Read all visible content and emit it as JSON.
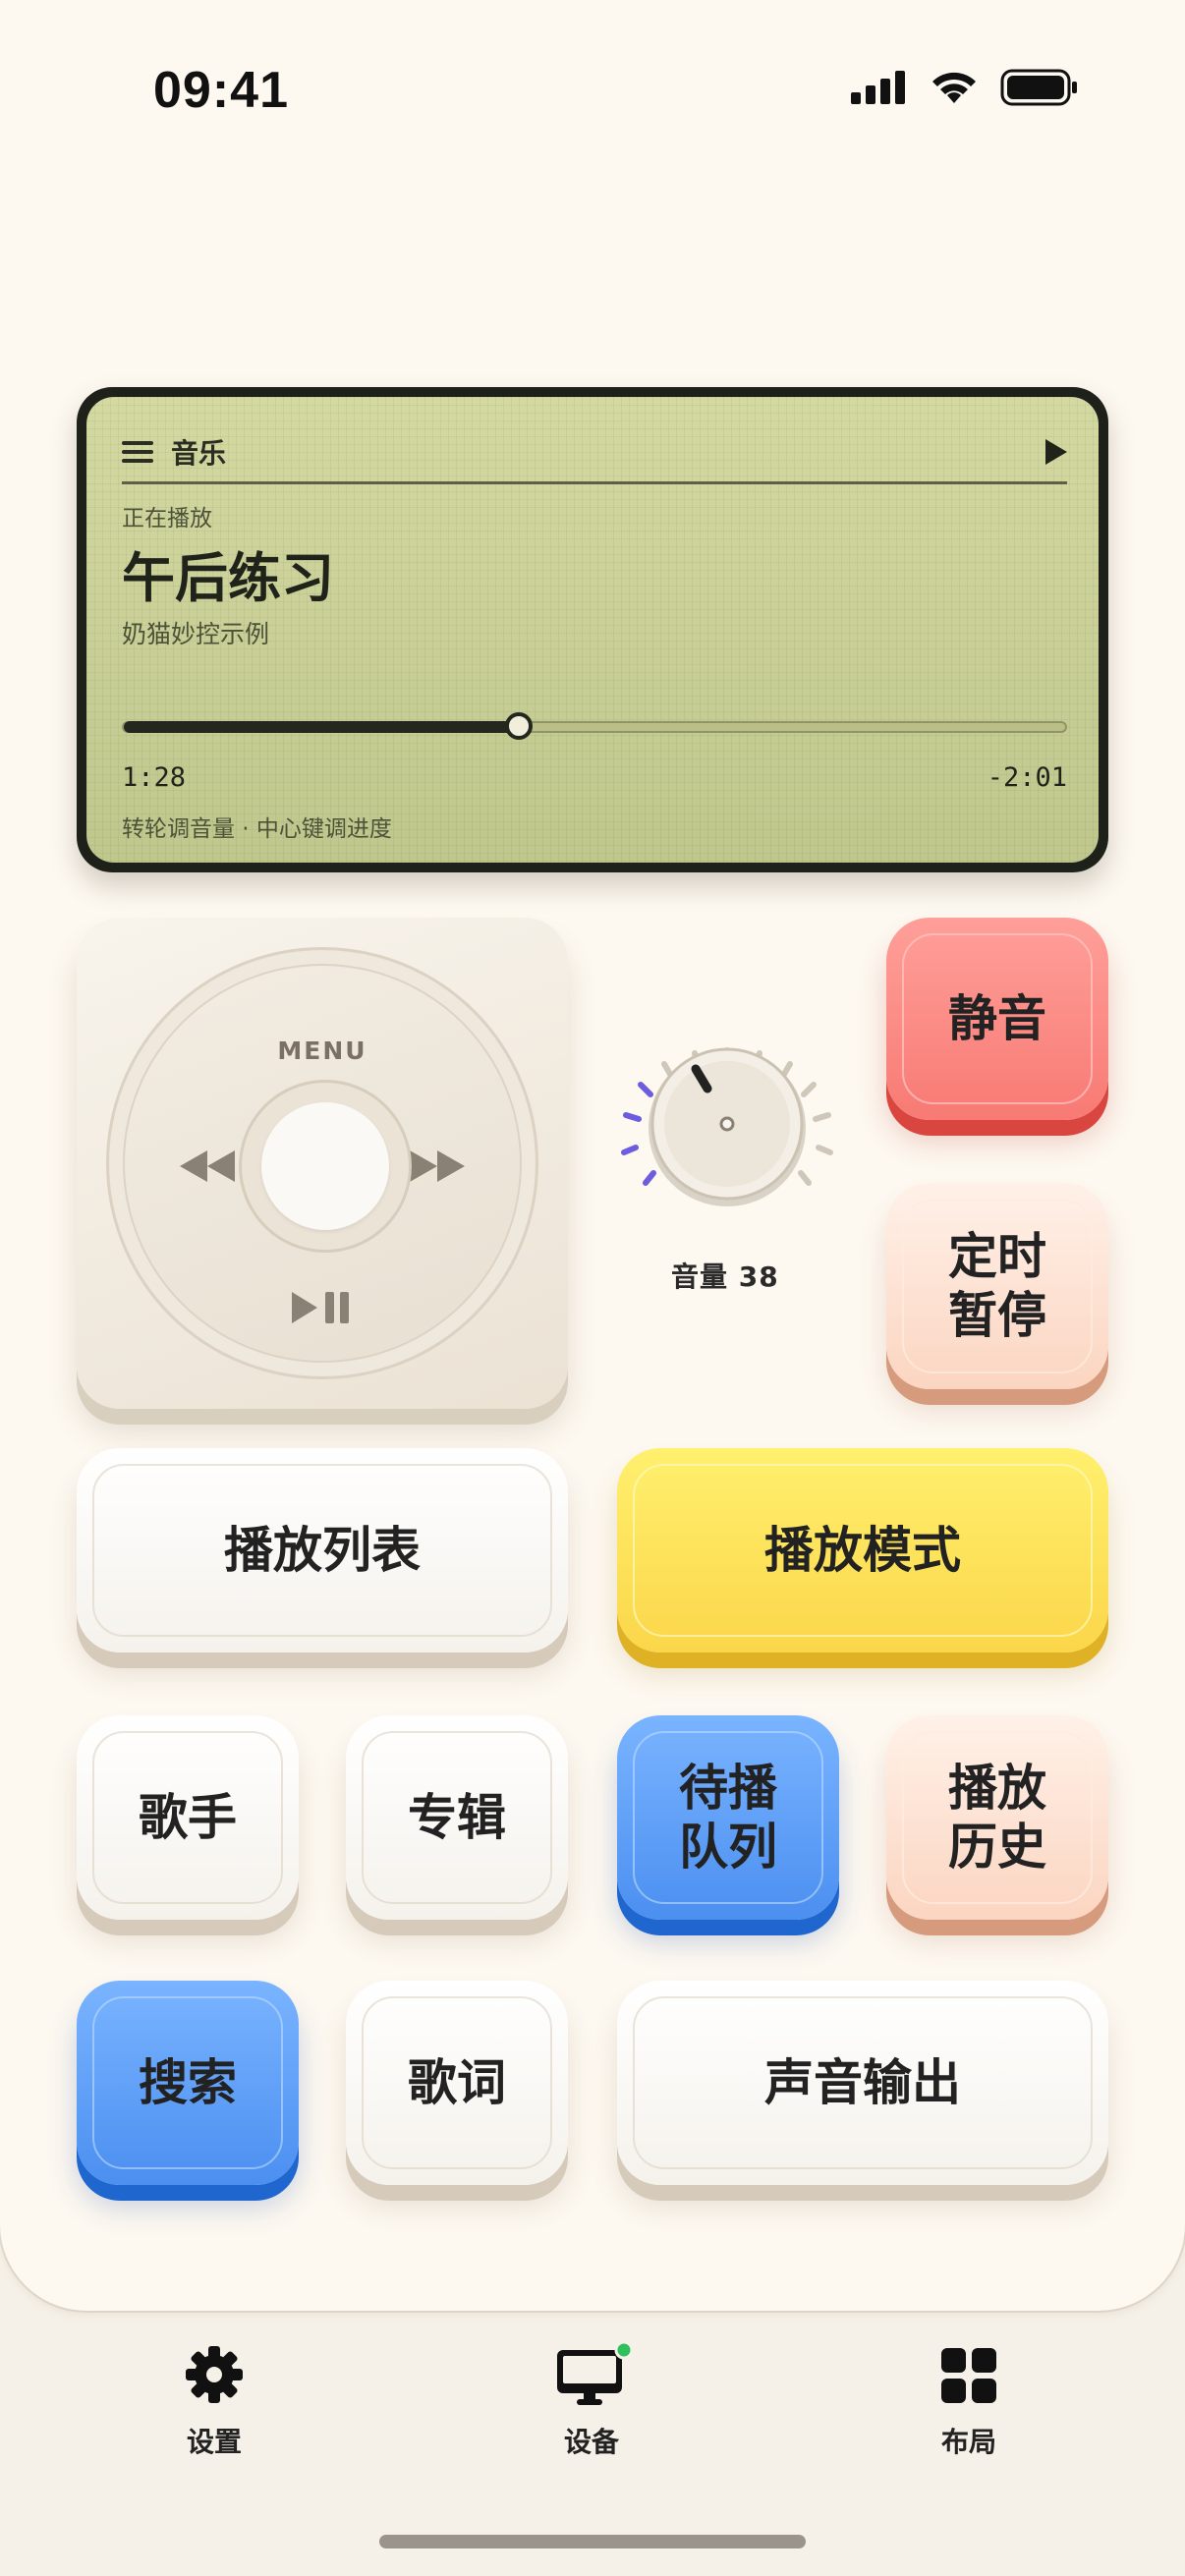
{
  "status_bar": {
    "time": "09:41"
  },
  "lcd": {
    "header_title": "音乐",
    "now_playing_label": "正在播放",
    "song_title": "午后练习",
    "artist": "奶猫妙控示例",
    "progress_fraction": 0.42,
    "elapsed": "1:28",
    "remaining": "-2:01",
    "hint": "转轮调音量 · 中心键调进度"
  },
  "wheel": {
    "menu_label": "MENU"
  },
  "volume": {
    "label": "音量 38",
    "value": 38
  },
  "buttons": {
    "mute": "静音",
    "sleep_timer": "定时\n暂停",
    "playlist": "播放列表",
    "play_mode": "播放模式",
    "artists": "歌手",
    "albums": "专辑",
    "queue": "待播\n队列",
    "history": "播放\n历史",
    "search": "搜索",
    "lyrics": "歌词",
    "audio_output": "声音输出"
  },
  "tabbar": {
    "settings": "设置",
    "devices": "设备",
    "layout": "布局"
  },
  "icons": {
    "settings": "gear-icon",
    "devices": "monitor-icon",
    "layout": "grid-icon"
  },
  "colors": {
    "accent_green_dot": "#2fbf5b",
    "volume_tick_active": "#6b5ce0",
    "lcd_background": "#cbd195"
  }
}
